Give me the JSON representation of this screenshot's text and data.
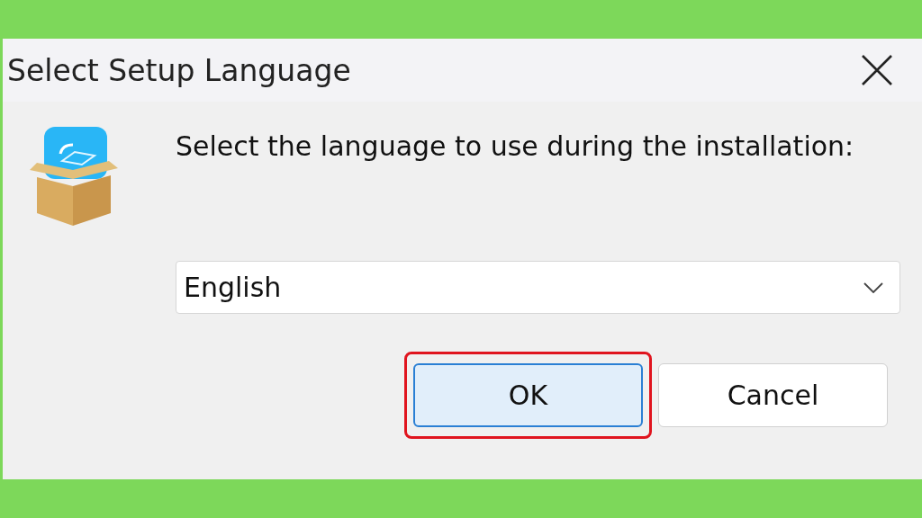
{
  "window": {
    "title": "Select Setup Language"
  },
  "prompt": "Select the language to use during the installation:",
  "language_select": {
    "value": "English"
  },
  "buttons": [
    {
      "label": "OK",
      "selected": true,
      "highlighted": true
    },
    {
      "label": "Cancel",
      "selected": false,
      "highlighted": false
    }
  ]
}
